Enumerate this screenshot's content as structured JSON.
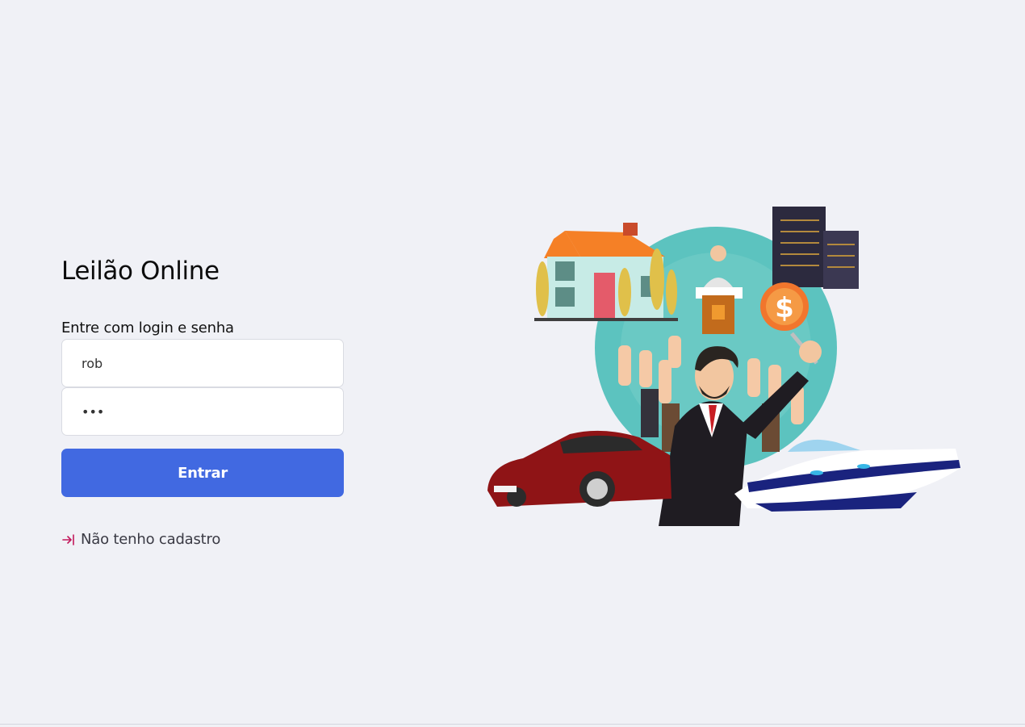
{
  "app": {
    "title": "Leilão Online"
  },
  "login": {
    "prompt": "Entre com login e senha",
    "username_value": "rob",
    "password_value": "abc",
    "submit_label": "Entrar",
    "register_label": "Não tenho cadastro",
    "register_icon": "login-arrow-icon"
  },
  "colors": {
    "background": "#f0f1f6",
    "primary": "#4169e1",
    "register_icon": "#c2185b"
  },
  "illustration": {
    "icon": "auction-illustration"
  }
}
